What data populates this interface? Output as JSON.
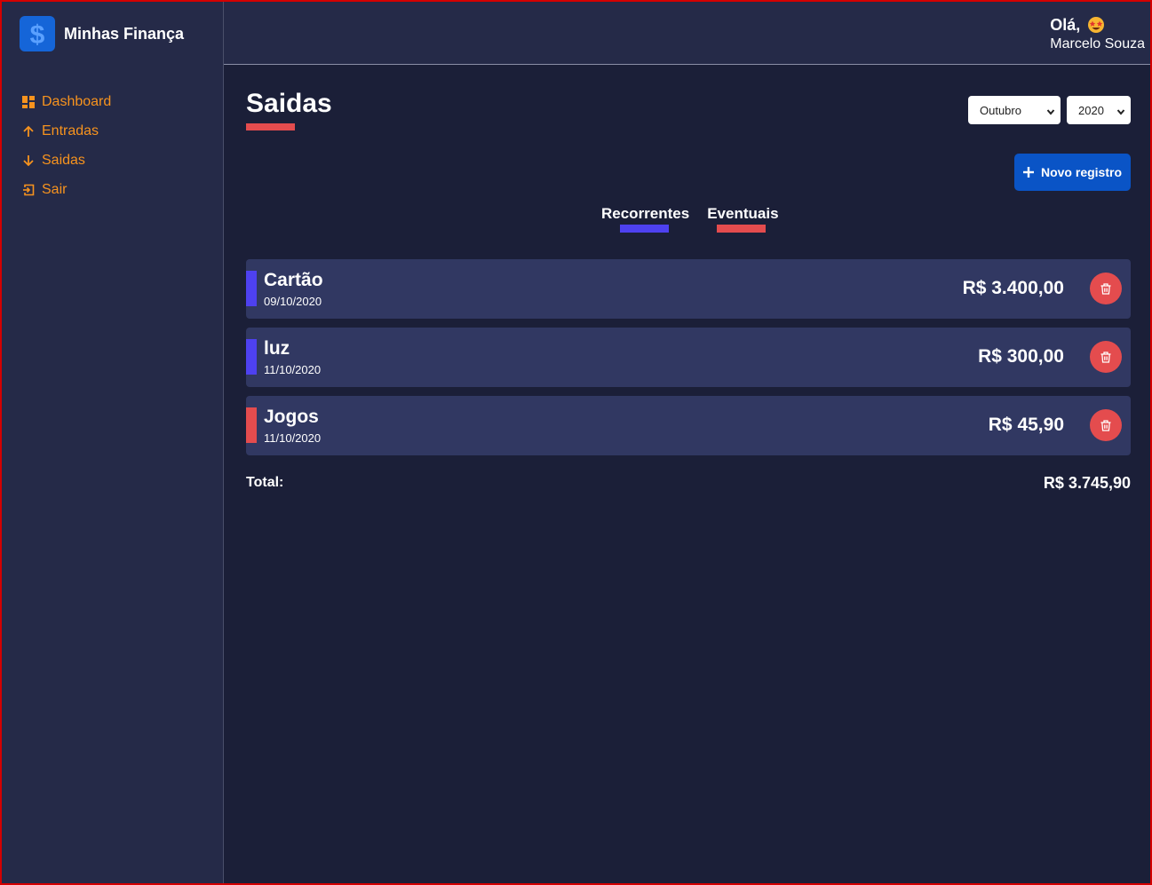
{
  "colors": {
    "background": "#1b1f38",
    "panel": "#252a48",
    "row": "#313862",
    "menu_text": "#f7931e",
    "recurring": "#4e41f0",
    "eventual": "#e44c4e",
    "primary_button": "#0a54c6"
  },
  "brand": {
    "name": "Minhas Finança",
    "logo_icon": "dollar-icon"
  },
  "sidebar": {
    "items": [
      {
        "label": "Dashboard",
        "icon": "dashboard-icon"
      },
      {
        "label": "Entradas",
        "icon": "arrow-up-icon"
      },
      {
        "label": "Saidas",
        "icon": "arrow-down-icon"
      },
      {
        "label": "Sair",
        "icon": "logout-icon"
      }
    ]
  },
  "header": {
    "greeting": "Olá,",
    "greeting_icon": "star-struck-emoji-icon",
    "user_name": "Marcelo Souza"
  },
  "main": {
    "title": "Saidas",
    "month_select": {
      "value": "Outubro"
    },
    "year_select": {
      "value": "2020"
    },
    "new_button": {
      "label": "Novo registro",
      "icon": "plus-icon"
    },
    "filters": [
      {
        "label": "Recorrentes"
      },
      {
        "label": "Eventuais"
      }
    ],
    "entries": [
      {
        "name": "Cartão",
        "date": "09/10/2020",
        "amount": "R$ 3.400,00",
        "frequency": "recorrente"
      },
      {
        "name": "luz",
        "date": "11/10/2020",
        "amount": "R$ 300,00",
        "frequency": "recorrente"
      },
      {
        "name": "Jogos",
        "date": "11/10/2020",
        "amount": "R$ 45,90",
        "frequency": "eventual"
      }
    ],
    "total": {
      "label": "Total:",
      "value": "R$ 3.745,90"
    }
  }
}
